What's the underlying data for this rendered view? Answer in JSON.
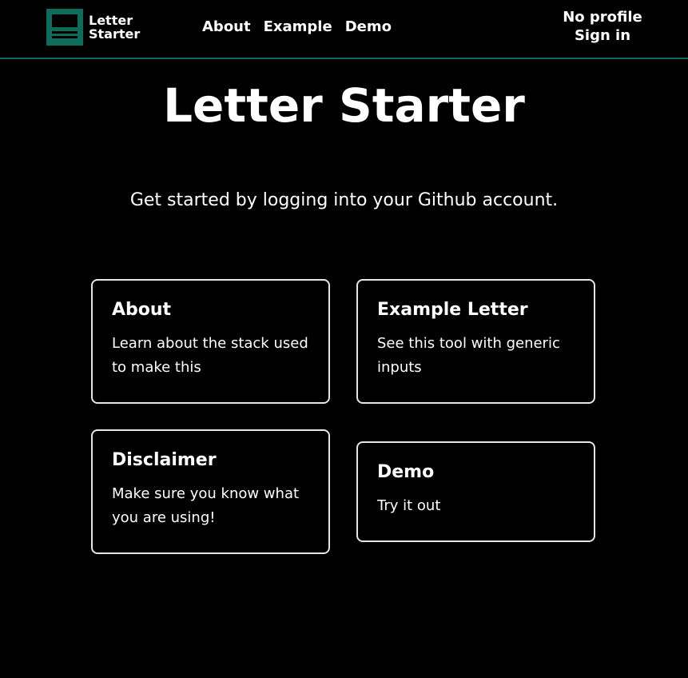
{
  "header": {
    "logo_text": "Letter\nStarter",
    "nav": [
      {
        "label": "About"
      },
      {
        "label": "Example"
      },
      {
        "label": "Demo"
      }
    ],
    "profile_status": "No profile",
    "sign_in_label": "Sign in"
  },
  "hero": {
    "title": "Letter Starter",
    "subtitle": "Get started by logging into your Github account."
  },
  "cards": [
    {
      "title": "About",
      "description": "Learn about the stack used to make this"
    },
    {
      "title": "Example Letter",
      "description": "See this tool with generic inputs"
    },
    {
      "title": "Disclaimer",
      "description": "Make sure you know what you are using!"
    },
    {
      "title": "Demo",
      "description": "Try it out"
    }
  ],
  "colors": {
    "accent": "#0f6b5a",
    "background": "#000000",
    "text": "#ffffff",
    "card_border": "#e6e6e6"
  },
  "icons": {
    "logo": "letter-starter-logo-icon"
  }
}
